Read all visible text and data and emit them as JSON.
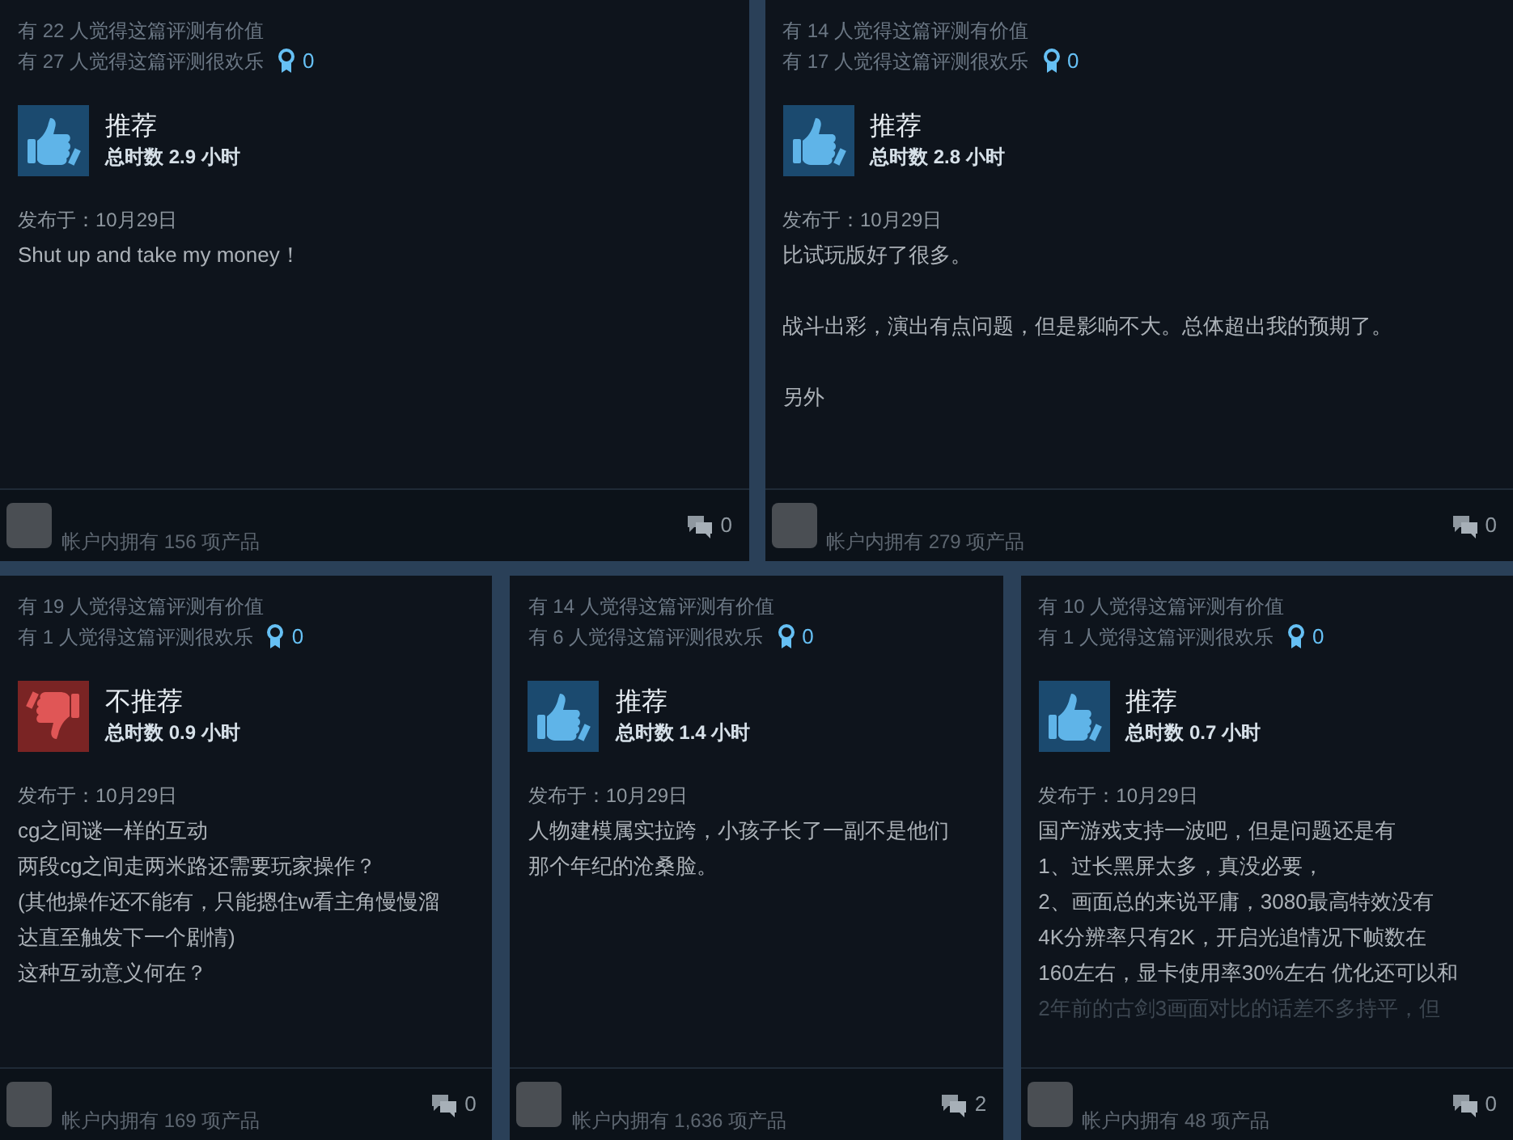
{
  "rows": [
    {
      "reviews": [
        {
          "helpful": "有 22 人觉得这篇评测有价值",
          "funny": "有 27 人觉得这篇评测很欢乐",
          "awards": "0",
          "recommended": true,
          "verdict": "推荐",
          "hours": "总时数 2.9 小时",
          "posted": "发布于：10月29日",
          "paragraphs": [
            [
              "Shut up and take my money！"
            ]
          ],
          "faded_last_line": false,
          "products": "帐户内拥有 156 项产品",
          "comments": "0"
        },
        {
          "helpful": "有 14 人觉得这篇评测有价值",
          "funny": "有 17 人觉得这篇评测很欢乐",
          "awards": "0",
          "recommended": true,
          "verdict": "推荐",
          "hours": "总时数 2.8 小时",
          "posted": "发布于：10月29日",
          "paragraphs": [
            [
              "比试玩版好了很多。"
            ],
            [
              "战斗出彩，演出有点问题，但是影响不大。总体超出我的预期了。"
            ],
            [
              "另外"
            ]
          ],
          "faded_last_line": false,
          "products": "帐户内拥有 279 项产品",
          "comments": "0"
        }
      ]
    },
    {
      "reviews": [
        {
          "helpful": "有 19 人觉得这篇评测有价值",
          "funny": "有 1 人觉得这篇评测很欢乐",
          "awards": "0",
          "recommended": false,
          "verdict": "不推荐",
          "hours": "总时数 0.9 小时",
          "posted": "发布于：10月29日",
          "paragraphs": [
            [
              "cg之间谜一样的互动",
              "两段cg之间走两米路还需要玩家操作？",
              "(其他操作还不能有，只能摁住w看主角慢慢溜",
              "达直至触发下一个剧情)",
              "这种互动意义何在？"
            ]
          ],
          "faded_last_line": false,
          "products": "帐户内拥有 169 项产品",
          "comments": "0"
        },
        {
          "helpful": "有 14 人觉得这篇评测有价值",
          "funny": "有 6 人觉得这篇评测很欢乐",
          "awards": "0",
          "recommended": true,
          "verdict": "推荐",
          "hours": "总时数 1.4 小时",
          "posted": "发布于：10月29日",
          "paragraphs": [
            [
              "人物建模属实拉跨，小孩子长了一副不是他们",
              "那个年纪的沧桑脸。"
            ]
          ],
          "faded_last_line": false,
          "products": "帐户内拥有 1,636 项产品",
          "comments": "2"
        },
        {
          "helpful": "有 10 人觉得这篇评测有价值",
          "funny": "有 1 人觉得这篇评测很欢乐",
          "awards": "0",
          "recommended": true,
          "verdict": "推荐",
          "hours": "总时数 0.7 小时",
          "posted": "发布于：10月29日",
          "paragraphs": [
            [
              "国产游戏支持一波吧，但是问题还是有",
              "1、过长黑屏太多，真没必要，",
              "2、画面总的来说平庸，3080最高特效没有",
              "4K分辨率只有2K，开启光追情况下帧数在",
              "160左右，显卡使用率30%左右 优化还可以和",
              "2年前的古剑3画面对比的话差不多持平，但"
            ]
          ],
          "faded_last_line": true,
          "products": "帐户内拥有 48 项产品",
          "comments": "0"
        }
      ]
    }
  ]
}
